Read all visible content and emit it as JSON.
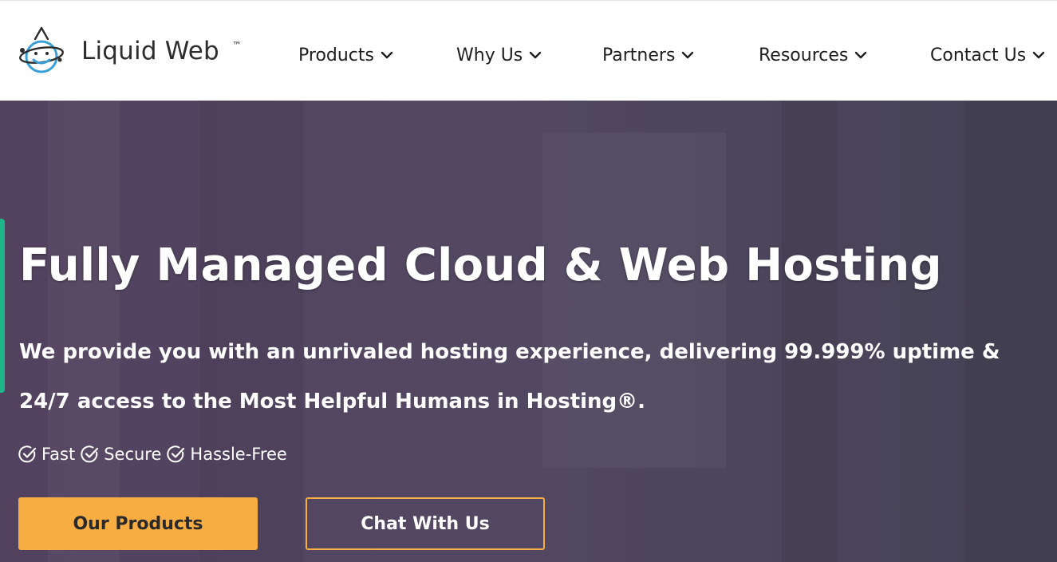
{
  "brand": {
    "name": "Liquid Web",
    "trademark": "™"
  },
  "nav": {
    "items": [
      {
        "label": "Products"
      },
      {
        "label": "Why Us"
      },
      {
        "label": "Partners"
      },
      {
        "label": "Resources"
      },
      {
        "label": "Contact Us"
      }
    ]
  },
  "hero": {
    "title": "Fully Managed Cloud & Web Hosting",
    "subtitle": "We provide you with an unrivaled hosting experience, delivering 99.999% uptime & 24/7 access to the Most Helpful Humans in Hosting®.",
    "features": [
      {
        "label": "Fast",
        "icon": "check-circle-icon"
      },
      {
        "label": "Secure",
        "icon": "check-circle-icon"
      },
      {
        "label": "Hassle-Free",
        "icon": "check-circle-icon"
      }
    ],
    "primary_button": "Our Products",
    "secondary_button": "Chat With Us"
  },
  "colors": {
    "accent": "#f8ad42",
    "side_tab": "#1fb58a",
    "logo_blue": "#3aa0d8"
  }
}
